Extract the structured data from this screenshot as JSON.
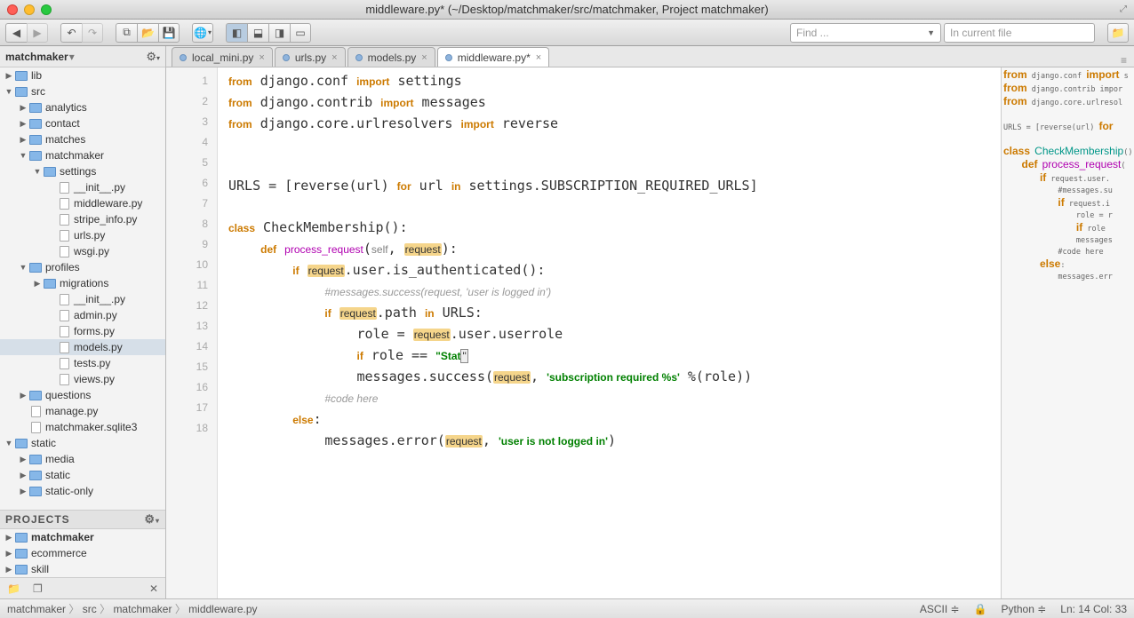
{
  "title": "middleware.py* (~/Desktop/matchmaker/src/matchmaker, Project matchmaker)",
  "toolbar": {
    "search_placeholder": "Find ...",
    "find_placeholder": "In current file"
  },
  "sidebar": {
    "project": "matchmaker",
    "section": "PROJECTS",
    "tree": [
      {
        "d": 0,
        "a": "closed",
        "t": "folder",
        "l": "lib"
      },
      {
        "d": 0,
        "a": "open",
        "t": "folder",
        "l": "src"
      },
      {
        "d": 1,
        "a": "closed",
        "t": "folder",
        "l": "analytics"
      },
      {
        "d": 1,
        "a": "closed",
        "t": "folder",
        "l": "contact"
      },
      {
        "d": 1,
        "a": "closed",
        "t": "folder",
        "l": "matches"
      },
      {
        "d": 1,
        "a": "open",
        "t": "folder",
        "l": "matchmaker"
      },
      {
        "d": 2,
        "a": "open",
        "t": "folder",
        "l": "settings"
      },
      {
        "d": 3,
        "a": "none",
        "t": "file",
        "l": "__init__.py"
      },
      {
        "d": 3,
        "a": "none",
        "t": "file",
        "l": "middleware.py"
      },
      {
        "d": 3,
        "a": "none",
        "t": "file",
        "l": "stripe_info.py"
      },
      {
        "d": 3,
        "a": "none",
        "t": "file",
        "l": "urls.py"
      },
      {
        "d": 3,
        "a": "none",
        "t": "file",
        "l": "wsgi.py"
      },
      {
        "d": 1,
        "a": "open",
        "t": "folder",
        "l": "profiles"
      },
      {
        "d": 2,
        "a": "closed",
        "t": "folder",
        "l": "migrations"
      },
      {
        "d": 3,
        "a": "none",
        "t": "file",
        "l": "__init__.py"
      },
      {
        "d": 3,
        "a": "none",
        "t": "file",
        "l": "admin.py"
      },
      {
        "d": 3,
        "a": "none",
        "t": "file",
        "l": "forms.py"
      },
      {
        "d": 3,
        "a": "none",
        "t": "file",
        "l": "models.py",
        "sel": true
      },
      {
        "d": 3,
        "a": "none",
        "t": "file",
        "l": "tests.py"
      },
      {
        "d": 3,
        "a": "none",
        "t": "file",
        "l": "views.py"
      },
      {
        "d": 1,
        "a": "closed",
        "t": "folder",
        "l": "questions"
      },
      {
        "d": 1,
        "a": "none",
        "t": "file",
        "l": "manage.py"
      },
      {
        "d": 1,
        "a": "none",
        "t": "file",
        "l": "matchmaker.sqlite3"
      },
      {
        "d": 0,
        "a": "open",
        "t": "folder",
        "l": "static"
      },
      {
        "d": 1,
        "a": "closed",
        "t": "folder",
        "l": "media"
      },
      {
        "d": 1,
        "a": "closed",
        "t": "folder",
        "l": "static"
      },
      {
        "d": 1,
        "a": "closed",
        "t": "folder",
        "l": "static-only"
      }
    ],
    "projects": [
      {
        "l": "matchmaker",
        "bold": true
      },
      {
        "l": "ecommerce"
      },
      {
        "l": "skill"
      }
    ]
  },
  "tabs": [
    {
      "l": "local_mini.py",
      "active": false
    },
    {
      "l": "urls.py",
      "active": false
    },
    {
      "l": "models.py",
      "active": false
    },
    {
      "l": "middleware.py*",
      "active": true
    }
  ],
  "code": {
    "lines": 18
  },
  "breadcrumb": [
    "matchmaker",
    "src",
    "matchmaker",
    "middleware.py"
  ],
  "status": {
    "encoding": "ASCII",
    "lang": "Python",
    "pos": "Ln: 14 Col: 33"
  },
  "minimap": [
    "from django.conf import s",
    "from django.contrib impor",
    "from django.core.urlresol",
    "",
    "URLS = [reverse(url) for",
    "",
    "class CheckMembership():",
    "    def process_request(",
    "        if request.user.",
    "            #messages.su",
    "            if request.i",
    "                role = r",
    "                if role ",
    "                messages",
    "            #code here",
    "        else:",
    "            messages.err"
  ]
}
